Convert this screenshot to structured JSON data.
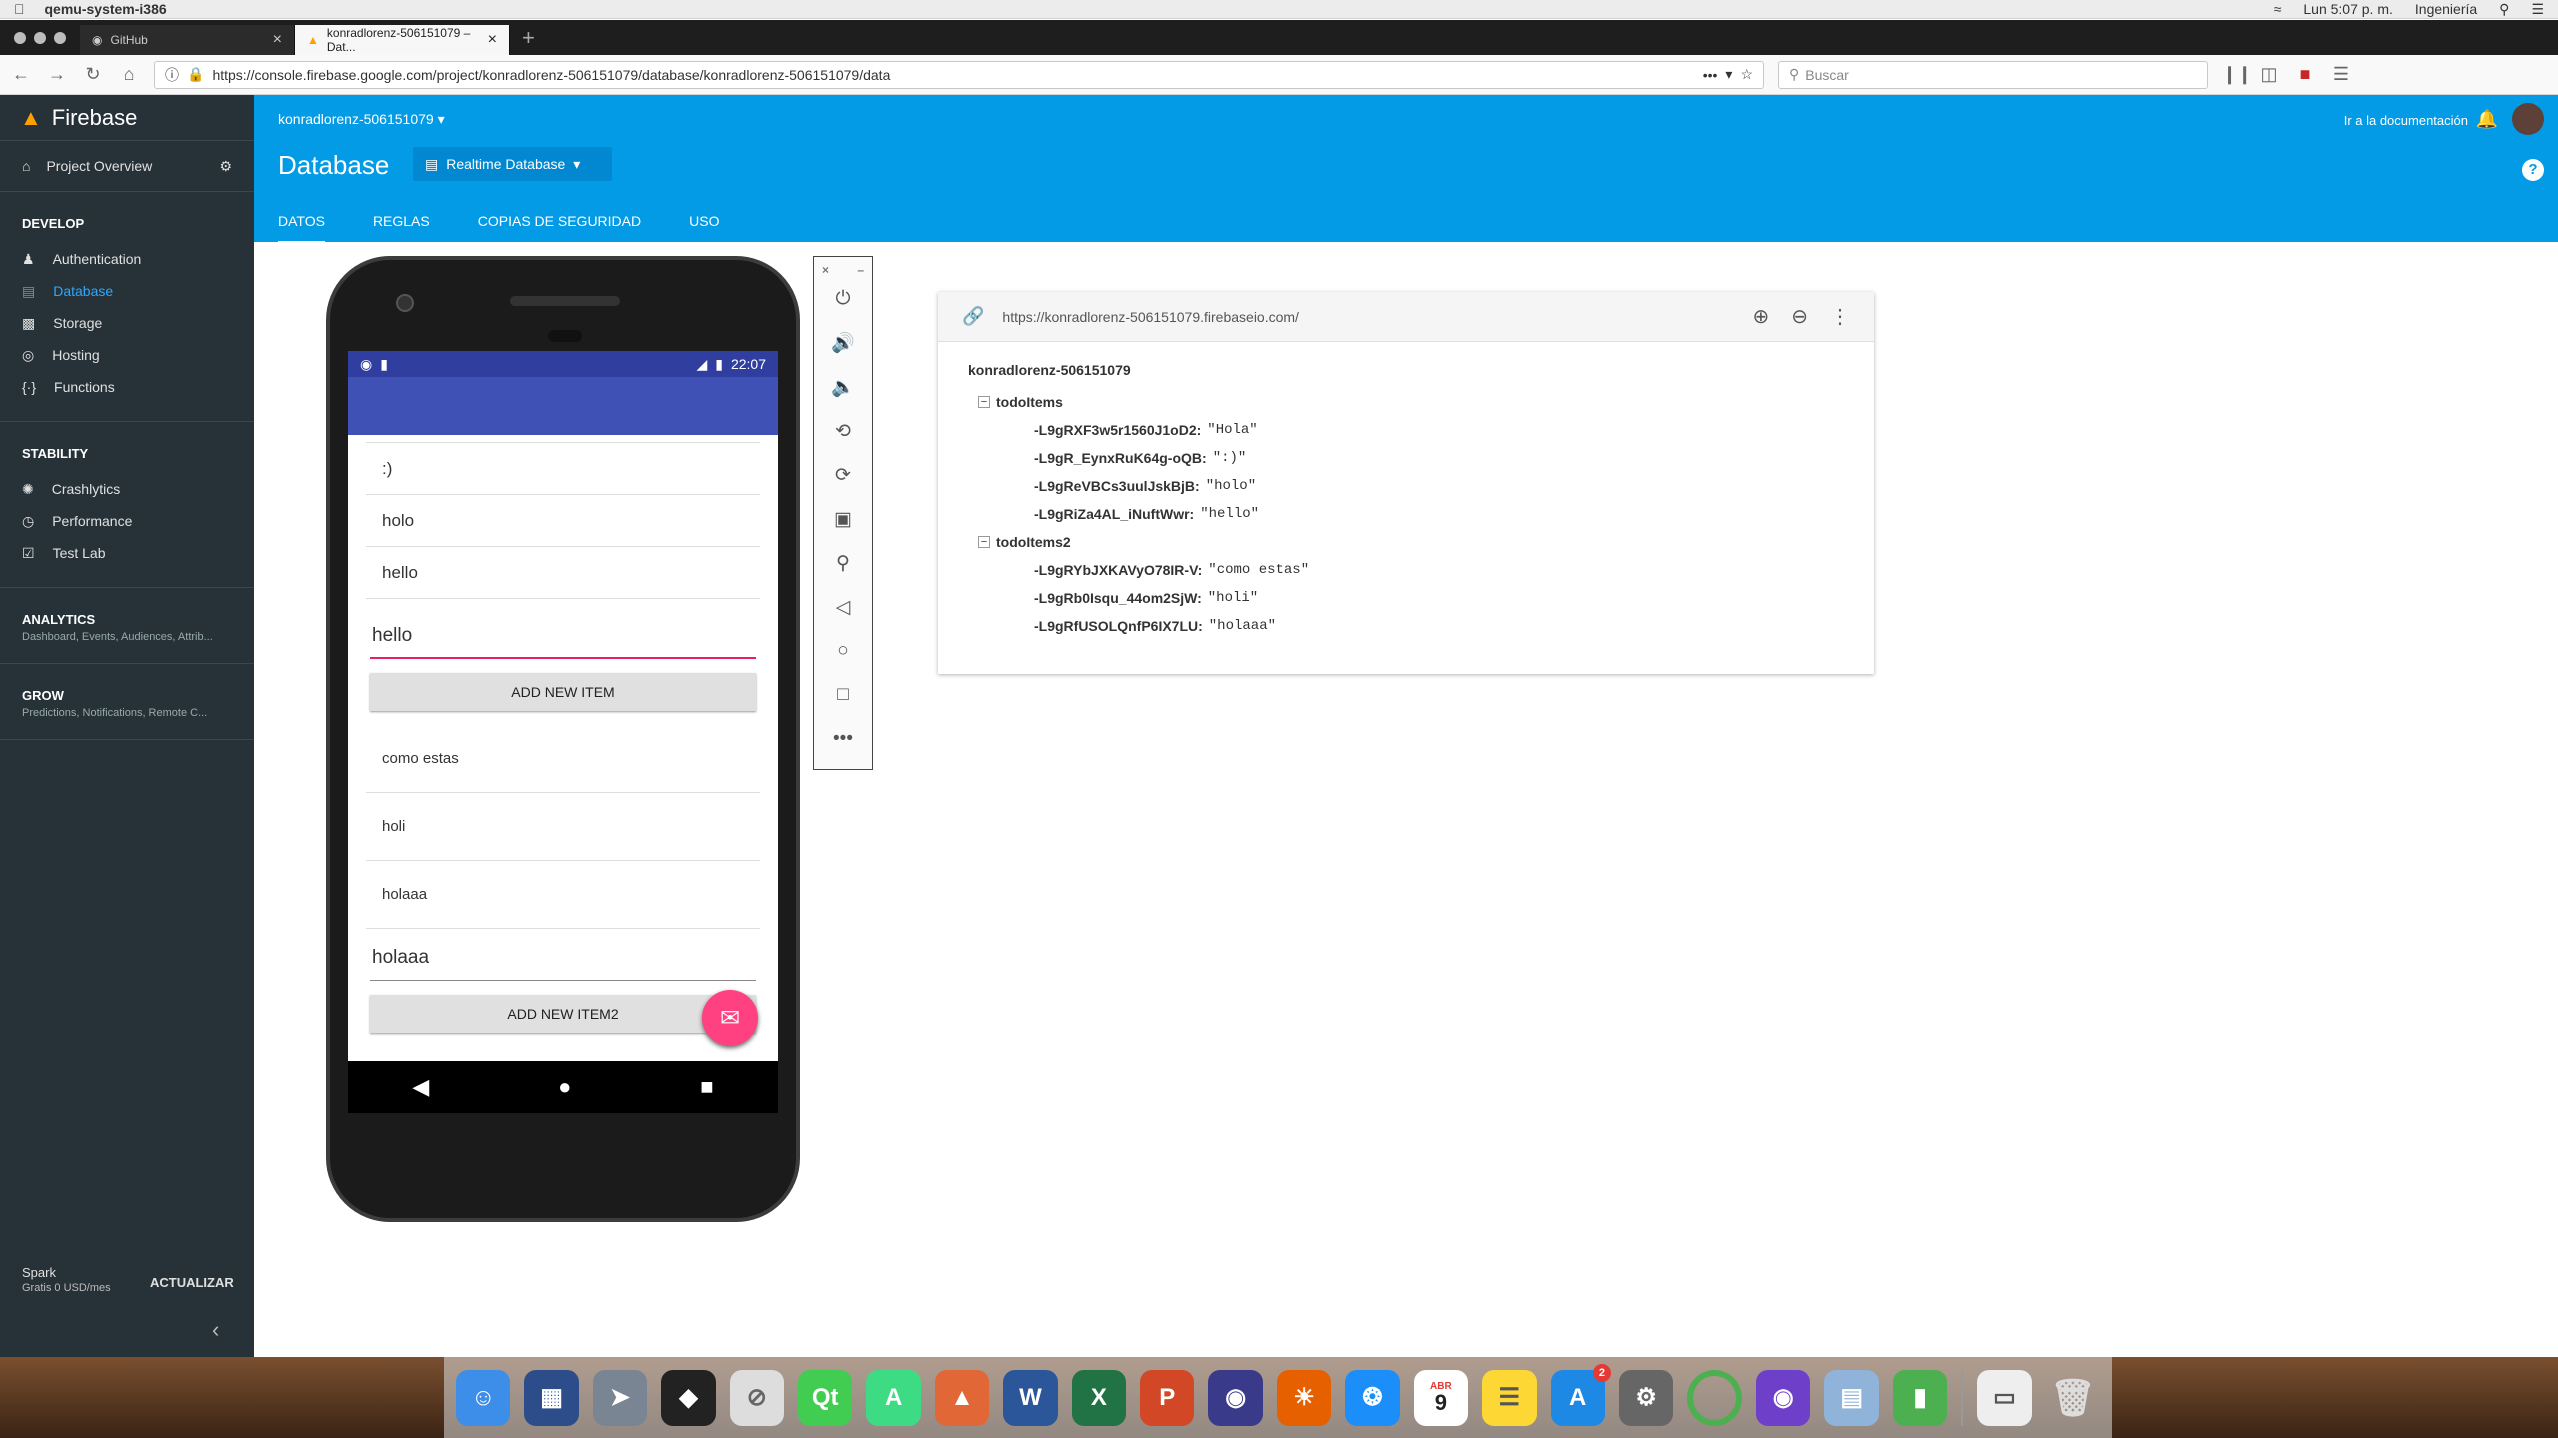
{
  "menubar": {
    "app": "qemu-system-i386",
    "clock": "Lun 5:07 p. m.",
    "user": "Ingeniería"
  },
  "browser": {
    "tabs": [
      {
        "title": "GitHub"
      },
      {
        "title": "konradlorenz-506151079 – Dat..."
      }
    ],
    "url": "https://console.firebase.google.com/project/konradlorenz-506151079/database/konradlorenz-506151079/data",
    "search_placeholder": "Buscar"
  },
  "sidebar": {
    "brand": "Firebase",
    "overview": "Project Overview",
    "develop": {
      "title": "DEVELOP",
      "items": [
        "Authentication",
        "Database",
        "Storage",
        "Hosting",
        "Functions"
      ]
    },
    "stability": {
      "title": "STABILITY",
      "items": [
        "Crashlytics",
        "Performance",
        "Test Lab"
      ]
    },
    "analytics": {
      "title": "ANALYTICS",
      "sub": "Dashboard, Events, Audiences, Attrib..."
    },
    "grow": {
      "title": "GROW",
      "sub": "Predictions, Notifications, Remote C..."
    },
    "plan": {
      "name": "Spark",
      "price": "Gratis 0 USD/mes",
      "upgrade": "ACTUALIZAR"
    },
    "collapse": "‹"
  },
  "header": {
    "project": "konradlorenz-506151079",
    "title": "Database",
    "db_select": "Realtime Database",
    "docs": "Ir a la documentación",
    "tabs": [
      "DATOS",
      "REGLAS",
      "COPIAS DE SEGURIDAD",
      "USO"
    ]
  },
  "phone": {
    "time": "22:07",
    "items1": [
      ":)",
      "holo",
      "hello"
    ],
    "input1": "hello",
    "button1": "ADD NEW ITEM",
    "items2": [
      "como estas",
      "holi",
      "holaaa"
    ],
    "input2": "holaaa",
    "button2": "ADD NEW ITEM2"
  },
  "db": {
    "url": "https://konradlorenz-506151079.firebaseio.com/",
    "root": "konradlorenz-506151079",
    "todoItems": {
      "name": "todoItems",
      "entries": [
        {
          "key": "-L9gRXF3w5r1560J1oD2:",
          "val": "\"Hola\""
        },
        {
          "key": "-L9gR_EynxRuK64g-oQB:",
          "val": "\":)\""
        },
        {
          "key": "-L9gReVBCs3uulJskBjB:",
          "val": "\"holo\""
        },
        {
          "key": "-L9gRiZa4AL_iNuftWwr:",
          "val": "\"hello\""
        }
      ]
    },
    "todoItems2": {
      "name": "todoItems2",
      "entries": [
        {
          "key": "-L9gRYbJXKAVyO78IR-V:",
          "val": "\"como estas\""
        },
        {
          "key": "-L9gRb0Isqu_44om2SjW:",
          "val": "\"holi\""
        },
        {
          "key": "-L9gRfUSOLQnfP6IX7LU:",
          "val": "\"holaaa\""
        }
      ]
    }
  },
  "dock": {
    "calendar_month": "ABR",
    "calendar_day": "9",
    "appstore_badge": "2"
  }
}
